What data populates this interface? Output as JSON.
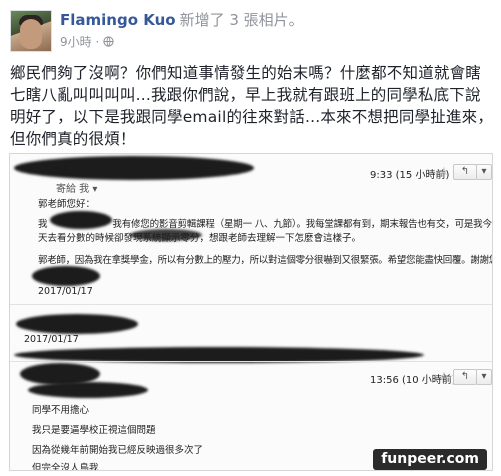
{
  "post": {
    "author": "Flamingo Kuo",
    "action": "新增了 3 張相片。",
    "time": "9小時 ·",
    "text": "鄉民們夠了沒啊？你們知道事情發生的始末嗎？什麼都不知道就會瞎七瞎八亂叫叫叫叫...我跟你們說，早上我就有跟班上的同學私底下說明好了，以下是我跟同學email的往來對話...本來不想把同學扯進來，但你們真的很煩！"
  },
  "email1": {
    "sender": "寄給 我 ▾",
    "time": "9:33 (15 小時前)",
    "greeting": "郭老師您好：",
    "line1": "我　　　　　　　我有修您的影音剪輯課程（星期一 八、九節）。我每堂課都有到，期末報告也有交，可是我今",
    "line2": "天去看分數的時候卻發現系統顯示零分，想跟老師去理解一下怎麼會這樣子。",
    "line3": "郭老師，因為我在拿獎學金，所以有分數上的壓力，所以對這個零分很嚇到又很緊張。希望您能盡快回覆。謝謝您！",
    "date": "2017/01/17"
  },
  "email2": {
    "date": "2017/01/17",
    "time": "13:56 (10 小時前)",
    "lines": [
      "同學不用擔心",
      "我只是要逼學校正視這個問題",
      "因為從幾年前開始我已經反映過很多次了",
      "但完全沒人鳥我"
    ]
  },
  "watermark": "funpeer.com",
  "icons": {
    "star": "☆",
    "reply": "↰",
    "more": "▾"
  }
}
